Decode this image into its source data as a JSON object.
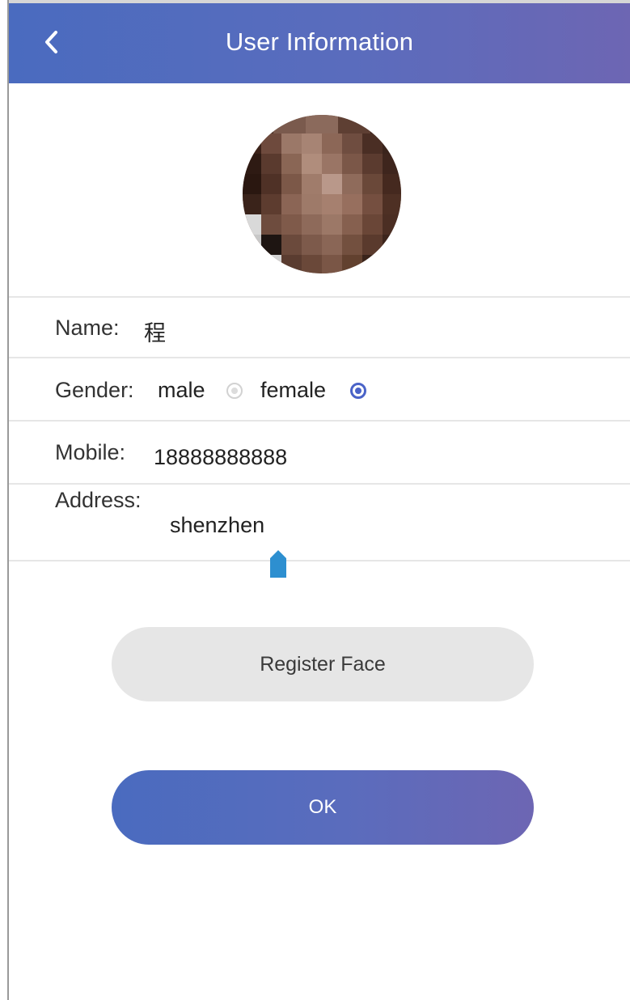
{
  "header": {
    "title": "User Information",
    "back_icon": "chevron-left-icon"
  },
  "colors": {
    "header_gradient_start": "#4a6bbf",
    "header_gradient_end": "#6d66b3",
    "radio_selected": "#4a63c8",
    "register_button_bg": "#e6e6e6"
  },
  "profile": {
    "avatar": "pixelated-user-photo"
  },
  "form": {
    "name_label": "Name:",
    "name_value": "程",
    "gender_label": "Gender:",
    "gender_options": [
      {
        "label": "male",
        "selected": false
      },
      {
        "label": "female",
        "selected": true
      }
    ],
    "mobile_label": "Mobile:",
    "mobile_value": "18888888888",
    "address_label": "Address:",
    "address_value": "shenzhen"
  },
  "buttons": {
    "register_face": "Register Face",
    "ok": "OK"
  }
}
